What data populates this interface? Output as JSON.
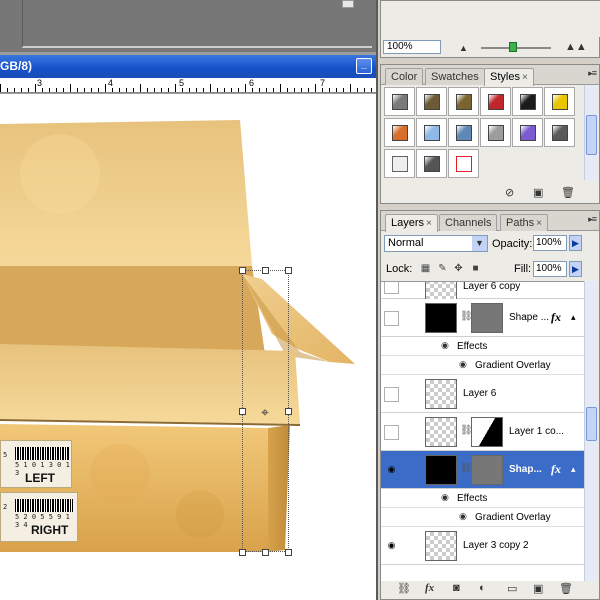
{
  "document": {
    "title_fragment": "GB/8)",
    "minimize_glyph": "_",
    "ruler_labels": [
      "3",
      "4",
      "5",
      "6",
      "7"
    ]
  },
  "canvas": {
    "sticker_left": {
      "text": "LEFT",
      "digits": "5 1 0 1 3 0 1 3"
    },
    "sticker_right": {
      "text": "RIGHT",
      "digits": "5 2 0 5 5 9 1 3 4",
      "side_num": "2"
    },
    "sticker_left_side_num": "5",
    "colors": {
      "box_light": "#f5d18a",
      "box_mid": "#e7b65d",
      "box_dark": "#c9953f"
    }
  },
  "navigator": {
    "zoom_value": "100%",
    "zoom_min_icon": "mountain-small-icon",
    "zoom_max_icon": "mountain-large-icon"
  },
  "styles_panel": {
    "tabs": [
      {
        "label": "Color",
        "close": ""
      },
      {
        "label": "Swatches",
        "close": ""
      },
      {
        "label": "Styles",
        "close": "×"
      }
    ],
    "menu_glyph": "▸≡",
    "swatch_colors": [
      "#7a7a7a",
      "#6b5a35",
      "#7a6530",
      "#c0262b",
      "#1b1b1b",
      "#e8c600",
      "#d86e2e",
      "#8fb8e8",
      "#5e88b5",
      "#9c9c9c",
      "#7b5bd0",
      "#5a5a5a",
      "#ffffff",
      "#555555",
      "#ffffff"
    ],
    "bottom_icons": [
      "no-style-icon",
      "new-style-icon",
      "trash-icon"
    ]
  },
  "layers_panel": {
    "tabs": [
      {
        "label": "Layers",
        "close": "×"
      },
      {
        "label": "Channels",
        "close": ""
      },
      {
        "label": "Paths",
        "close": "×"
      }
    ],
    "menu_glyph": "▸≡",
    "blend_mode": "Normal",
    "opacity_label": "Opacity:",
    "opacity_value": "100%",
    "lock_label": "Lock:",
    "fill_label": "Fill:",
    "fill_value": "100%",
    "layers": [
      {
        "name": "Layer 6 copy",
        "visible": false,
        "selected": false
      },
      {
        "name": "Shape ...",
        "visible": false,
        "selected": false,
        "fx": "fx",
        "has_mask": true
      },
      {
        "name": "Effects",
        "kind": "effects"
      },
      {
        "name": "Gradient Overlay",
        "kind": "effect-item"
      },
      {
        "name": "Layer 6",
        "visible": false,
        "selected": false
      },
      {
        "name": "Layer 1 co...",
        "visible": false,
        "selected": false,
        "has_mask": true
      },
      {
        "name": "Shap...",
        "visible": true,
        "selected": true,
        "fx": "fx",
        "has_mask": true
      },
      {
        "name": "Effects",
        "kind": "effects"
      },
      {
        "name": "Gradient Overlay",
        "kind": "effect-item"
      },
      {
        "name": "Layer 3 copy 2",
        "visible": true,
        "selected": false
      }
    ],
    "bottom_icons": [
      "link-icon",
      "fx-icon",
      "mask-icon",
      "adjustment-icon",
      "group-icon",
      "new-layer-icon",
      "trash-icon"
    ]
  }
}
